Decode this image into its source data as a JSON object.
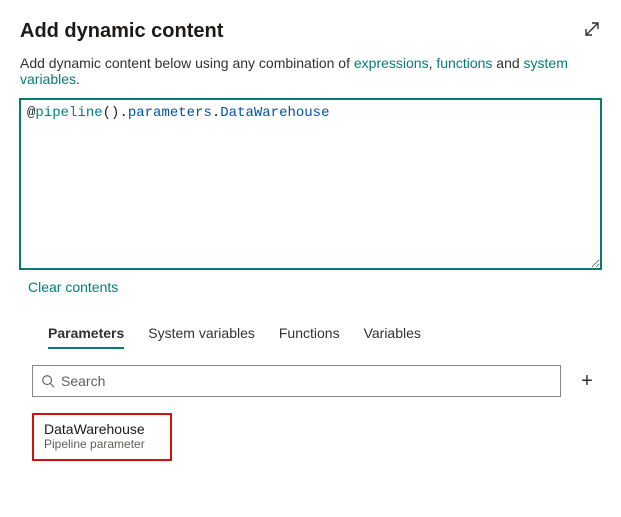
{
  "header": {
    "title": "Add dynamic content"
  },
  "description": {
    "prefix": "Add dynamic content below using any combination of ",
    "link_expressions": "expressions",
    "sep1": ", ",
    "link_functions": "functions",
    "sep2": " and ",
    "link_system_variables": "system variables",
    "suffix": "."
  },
  "editor": {
    "at": "@",
    "func": "pipeline",
    "paren": "()",
    "dot1": ".",
    "prop1": "parameters",
    "dot2": ".",
    "prop2": "DataWarehouse"
  },
  "actions": {
    "clear": "Clear contents"
  },
  "tabs": {
    "parameters": "Parameters",
    "system_variables": "System variables",
    "functions": "Functions",
    "variables": "Variables"
  },
  "search": {
    "placeholder": "Search"
  },
  "add": {
    "label": "+"
  },
  "params": [
    {
      "name": "DataWarehouse",
      "type": "Pipeline parameter"
    }
  ]
}
